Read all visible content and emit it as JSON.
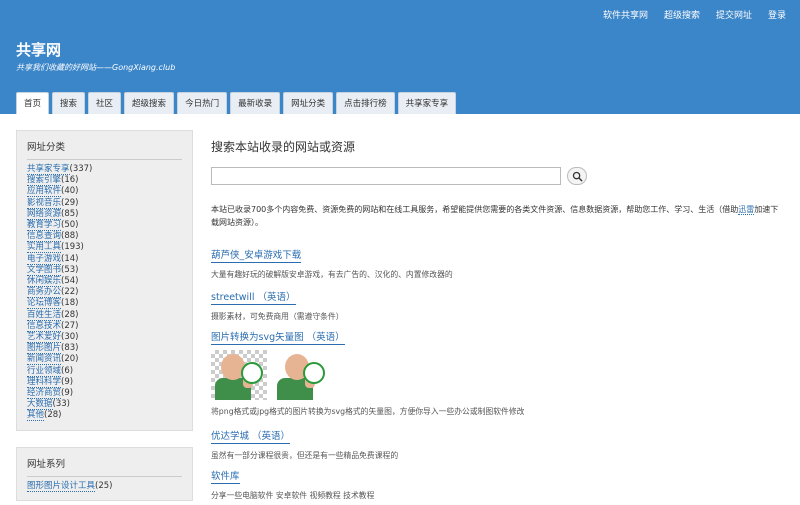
{
  "top_nav": [
    "软件共享网",
    "超级搜索",
    "提交网址",
    "登录"
  ],
  "site": {
    "title": "共享网",
    "subtitle": "共享我们收藏的好网站——GongXiang.club"
  },
  "tabs": [
    {
      "label": "首页",
      "active": true
    },
    {
      "label": "搜索"
    },
    {
      "label": "社区"
    },
    {
      "label": "超级搜索"
    },
    {
      "label": "今日热门"
    },
    {
      "label": "最新收录"
    },
    {
      "label": "网址分类"
    },
    {
      "label": "点击排行榜"
    },
    {
      "label": "共享家专享"
    }
  ],
  "sidebar": {
    "categories_title": "网址分类",
    "categories": [
      {
        "name": "共享家专享",
        "count": "(337)"
      },
      {
        "name": "搜索引擎",
        "count": "(16)"
      },
      {
        "name": "应用软件",
        "count": "(40)"
      },
      {
        "name": "影视音乐",
        "count": "(29)"
      },
      {
        "name": "网络资源",
        "count": "(85)"
      },
      {
        "name": "教育学习",
        "count": "(50)"
      },
      {
        "name": "信息查询",
        "count": "(88)"
      },
      {
        "name": "实用工具",
        "count": "(193)"
      },
      {
        "name": "电子游戏",
        "count": "(14)"
      },
      {
        "name": "文学图书",
        "count": "(53)"
      },
      {
        "name": "休闲娱乐",
        "count": "(54)"
      },
      {
        "name": "商务办公",
        "count": "(22)"
      },
      {
        "name": "论坛博客",
        "count": "(18)"
      },
      {
        "name": "百姓生活",
        "count": "(28)"
      },
      {
        "name": "信息技术",
        "count": "(27)"
      },
      {
        "name": "艺术爱好",
        "count": "(30)"
      },
      {
        "name": "图形图片",
        "count": "(83)"
      },
      {
        "name": "新闻资讯",
        "count": "(20)"
      },
      {
        "name": "行业领域",
        "count": "(6)"
      },
      {
        "name": "理科科学",
        "count": "(9)"
      },
      {
        "name": "经济商贸",
        "count": "(9)"
      },
      {
        "name": "大数据",
        "count": "(33)"
      },
      {
        "name": "其他",
        "count": "(28)"
      }
    ],
    "series_title": "网址系列",
    "series": [
      {
        "name": "图形图片设计工具",
        "count": "(25)"
      }
    ]
  },
  "main": {
    "title": "搜索本站收录的网站或资源",
    "search_placeholder": "",
    "search_icon": "search-icon",
    "intro_text": "本站已收录700多个内容免费、资源免费的网站和在线工具服务，希望能提供您需要的各类文件资源、信息数据资源，帮助您工作、学习、生活（借助",
    "intro_link": "迅雷",
    "intro_tail": "加速下载网站资源）。",
    "entries": [
      {
        "title": "葫芦侠_安卓游戏下载",
        "desc": "大量有趣好玩的破解版安卓游戏，有去广告的、汉化的、内置修改器的"
      },
      {
        "title": "streetwill （英语）",
        "desc": "摄影素材，可免费商用（需遵守条件）"
      },
      {
        "title": "图片转换为svg矢量图 （英语）",
        "desc": "将png格式或jpg格式的图片转换为svg格式的矢量图，方便你导入一些办公或制图软件修改"
      },
      {
        "title": "优达学城 （英语）",
        "desc": "虽然有一部分课程很贵，但还是有一些精品免费课程的"
      },
      {
        "title": "软件库",
        "desc": "分享一些电脑软件 安卓软件 视频教程 技术教程"
      }
    ]
  },
  "colors": {
    "header_bg": "#3b85c9",
    "link": "#2a6db0"
  }
}
